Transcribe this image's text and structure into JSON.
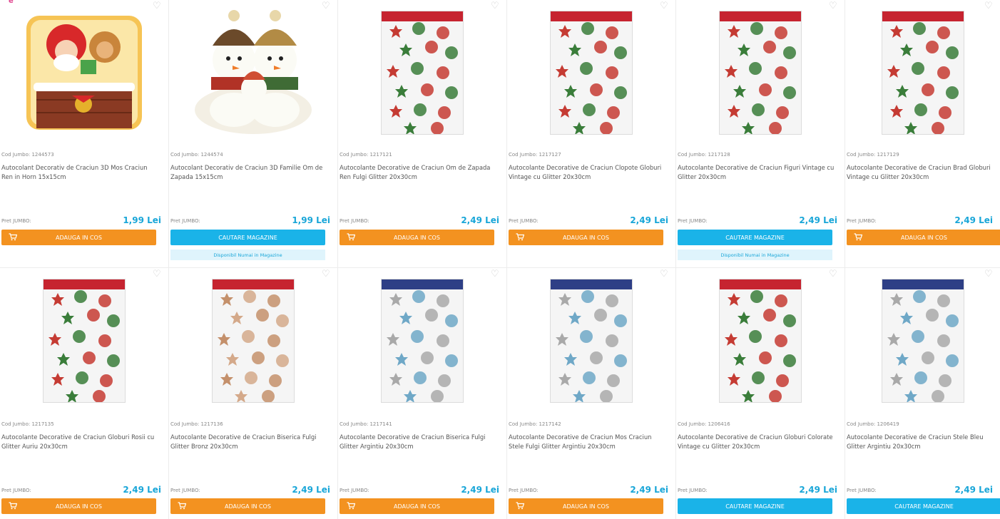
{
  "labels": {
    "price_label": "Pret JUMBO:",
    "add_to_cart": "ADAUGA IN COS",
    "search_stores": "CAUTARE MAGAZINE",
    "stores_only": "Disponibil Numai in Magazine",
    "logo_peek": "e"
  },
  "colors": {
    "accent_orange": "#f39220",
    "accent_blue": "#1ab3e8",
    "price_blue": "#19a6d8"
  },
  "products": [
    {
      "code": "Cod Jumbo: 1244573",
      "title": "Autocolant Decorativ de Craciun 3D Mos Craciun Ren in Horn 15x15cm",
      "price": "1,99 Lei",
      "action": "add",
      "stores_only": false,
      "art": "santa"
    },
    {
      "code": "Cod Jumbo: 1244574",
      "title": "Autocolant Decorativ de Craciun 3D Familie Om de Zapada 15x15cm",
      "price": "1,99 Lei",
      "action": "stores",
      "stores_only": true,
      "art": "snowmen"
    },
    {
      "code": "Cod Jumbo: 1217121",
      "title": "Autocolante Decorative de Craciun Om de Zapada Ren Fulgi Glitter 20x30cm",
      "price": "2,49 Lei",
      "action": "add",
      "stores_only": false,
      "art": "sheet-red"
    },
    {
      "code": "Cod Jumbo: 1217127",
      "title": "Autocolante Decorative de Craciun Clopote Globuri Vintage cu Glitter 20x30cm",
      "price": "2,49 Lei",
      "action": "add",
      "stores_only": false,
      "art": "sheet-red"
    },
    {
      "code": "Cod Jumbo: 1217128",
      "title": "Autocolante Decorative de Craciun Figuri Vintage cu Glitter 20x30cm",
      "price": "2,49 Lei",
      "action": "stores",
      "stores_only": true,
      "art": "sheet-red"
    },
    {
      "code": "Cod Jumbo: 1217129",
      "title": "Autocolante Decorative de Craciun Brad Globuri Vintage cu Glitter 20x30cm",
      "price": "2,49 Lei",
      "action": "add",
      "stores_only": false,
      "art": "sheet-red"
    },
    {
      "code": "Cod Jumbo: 1217135",
      "title": "Autocolante Decorative de Craciun Globuri Rosii cu Glitter Auriu 20x30cm",
      "price": "2,49 Lei",
      "action": "add",
      "stores_only": false,
      "art": "sheet-red"
    },
    {
      "code": "Cod Jumbo: 1217136",
      "title": "Autocolante Decorative de Craciun Biserica Fulgi Glitter Bronz 20x30cm",
      "price": "2,49 Lei",
      "action": "add",
      "stores_only": false,
      "art": "sheet-bronze"
    },
    {
      "code": "Cod Jumbo: 1217141",
      "title": "Autocolante Decorative de Craciun Biserica Fulgi Glitter Argintiu 20x30cm",
      "price": "2,49 Lei",
      "action": "add",
      "stores_only": false,
      "art": "sheet-blue"
    },
    {
      "code": "Cod Jumbo: 1217142",
      "title": "Autocolante Decorative de Craciun Mos Craciun Stele Fulgi Glitter Argintiu 20x30cm",
      "price": "2,49 Lei",
      "action": "add",
      "stores_only": false,
      "art": "sheet-blue"
    },
    {
      "code": "Cod Jumbo: 1206416",
      "title": "Autocolante Decorative de Craciun Globuri Colorate Vintage cu Glitter 20x30cm",
      "price": "2,49 Lei",
      "action": "stores",
      "stores_only": false,
      "art": "sheet-red"
    },
    {
      "code": "Cod Jumbo: 1206419",
      "title": "Autocolante Decorative de Craciun Stele Bleu Glitter Argintiu 20x30cm",
      "price": "2,49 Lei",
      "action": "stores",
      "stores_only": false,
      "art": "sheet-blue"
    }
  ]
}
